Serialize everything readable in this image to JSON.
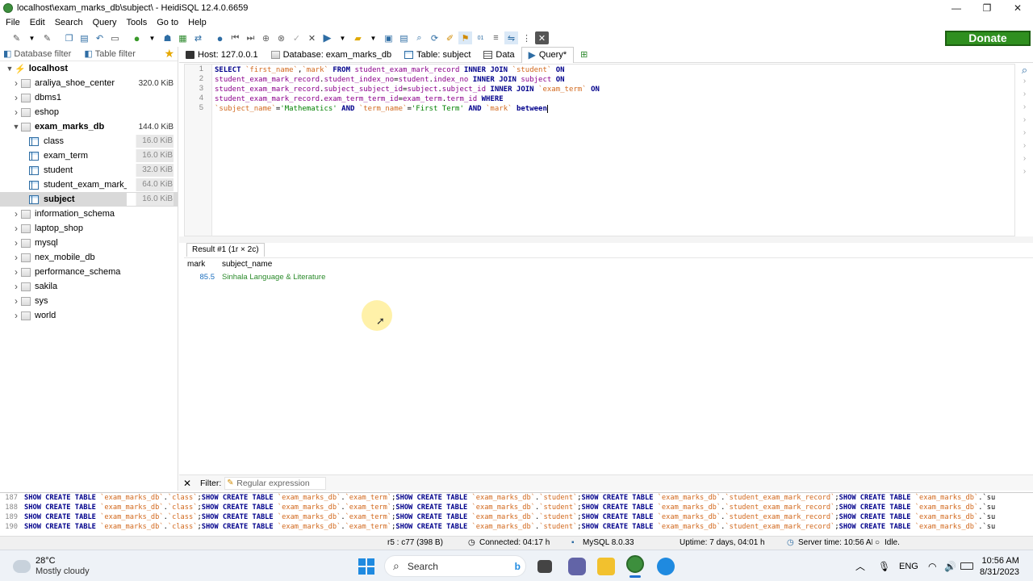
{
  "window": {
    "title": "localhost\\exam_marks_db\\subject\\ - HeidiSQL 12.4.0.6659",
    "buttons": [
      "—",
      "❐",
      "✕"
    ]
  },
  "menu": [
    "File",
    "Edit",
    "Search",
    "Query",
    "Tools",
    "Go to",
    "Help"
  ],
  "donate_label": "Donate",
  "left": {
    "database_filter": "Database filter",
    "table_filter": "Table filter",
    "root": "localhost",
    "items": [
      {
        "name": "araliya_shoe_center",
        "size": "320.0 KiB",
        "type": "db",
        "expanded": false
      },
      {
        "name": "dbms1",
        "size": "",
        "type": "db",
        "expanded": false
      },
      {
        "name": "eshop",
        "size": "",
        "type": "db",
        "expanded": false
      },
      {
        "name": "exam_marks_db",
        "size": "144.0 KiB",
        "type": "db",
        "expanded": true
      },
      {
        "name": "class",
        "size": "16.0 KiB",
        "type": "table"
      },
      {
        "name": "exam_term",
        "size": "16.0 KiB",
        "type": "table"
      },
      {
        "name": "student",
        "size": "32.0 KiB",
        "type": "table"
      },
      {
        "name": "student_exam_mark_r...",
        "size": "64.0 KiB",
        "type": "table"
      },
      {
        "name": "subject",
        "size": "16.0 KiB",
        "type": "table",
        "selected": true
      },
      {
        "name": "information_schema",
        "size": "",
        "type": "db",
        "expanded": false
      },
      {
        "name": "laptop_shop",
        "size": "",
        "type": "db",
        "expanded": false
      },
      {
        "name": "mysql",
        "size": "",
        "type": "db",
        "expanded": false
      },
      {
        "name": "nex_mobile_db",
        "size": "",
        "type": "db",
        "expanded": false
      },
      {
        "name": "performance_schema",
        "size": "",
        "type": "db",
        "expanded": false
      },
      {
        "name": "sakila",
        "size": "",
        "type": "db",
        "expanded": false
      },
      {
        "name": "sys",
        "size": "",
        "type": "db",
        "expanded": false
      },
      {
        "name": "world",
        "size": "",
        "type": "db",
        "expanded": false
      }
    ]
  },
  "tabs": {
    "host": "Host: 127.0.0.1",
    "database": "Database: exam_marks_db",
    "table": "Table: subject",
    "data": "Data",
    "query": "Query*"
  },
  "editor": {
    "line_numbers": [
      "1",
      "2",
      "3",
      "4",
      "5"
    ],
    "lines": [
      "SELECT `first_name`,`mark` FROM student_exam_mark_record INNER JOIN `student` ON",
      "student_exam_mark_record.student_index_no=student.index_no INNER JOIN subject ON",
      "student_exam_mark_record.subject_subject_id=subject.subject_id INNER JOIN `exam_term` ON",
      "student_exam_mark_record.exam_term_term_id=exam_term.term_id WHERE",
      "`subject_name`='Mathematics' AND `term_name`='First Term' AND `mark` between"
    ]
  },
  "results": {
    "tab_label": "Result #1 (1r × 2c)",
    "columns": [
      "mark",
      "subject_name"
    ],
    "rows": [
      [
        "85.5",
        "Sinhala Language & Literature"
      ]
    ]
  },
  "filter": {
    "label": "Filter:",
    "placeholder": "Regular expression"
  },
  "log": [
    {
      "n": "187",
      "text": "SHOW CREATE TABLE `exam_marks_db`.`class`;SHOW CREATE TABLE `exam_marks_db`.`exam_term`;SHOW CREATE TABLE `exam_marks_db`.`student`;SHOW CREATE TABLE `exam_marks_db`.`student_exam_mark_record`;SHOW CREATE TABLE `exam_marks_db`.`su"
    },
    {
      "n": "188",
      "text": "SHOW CREATE TABLE `exam_marks_db`.`class`;SHOW CREATE TABLE `exam_marks_db`.`exam_term`;SHOW CREATE TABLE `exam_marks_db`.`student`;SHOW CREATE TABLE `exam_marks_db`.`student_exam_mark_record`;SHOW CREATE TABLE `exam_marks_db`.`su"
    },
    {
      "n": "189",
      "text": "SHOW CREATE TABLE `exam_marks_db`.`class`;SHOW CREATE TABLE `exam_marks_db`.`exam_term`;SHOW CREATE TABLE `exam_marks_db`.`student`;SHOW CREATE TABLE `exam_marks_db`.`student_exam_mark_record`;SHOW CREATE TABLE `exam_marks_db`.`su"
    },
    {
      "n": "190",
      "text": "SHOW CREATE TABLE `exam_marks_db`.`class`;SHOW CREATE TABLE `exam_marks_db`.`exam_term`;SHOW CREATE TABLE `exam_marks_db`.`student`;SHOW CREATE TABLE `exam_marks_db`.`student_exam_mark_record`;SHOW CREATE TABLE `exam_marks_db`.`su"
    }
  ],
  "status": {
    "cursor": "r5 : c77 (398 B)",
    "connected": "Connected: 04:17 h",
    "server": "MySQL 8.0.33",
    "uptime": "Uptime: 7 days, 04:01 h",
    "server_time": "Server time: 10:56 AM",
    "state": "Idle."
  },
  "taskbar": {
    "temperature": "28°C",
    "weather": "Mostly cloudy",
    "search": "Search",
    "lang": "ENG",
    "time": "10:56 AM",
    "date": "8/31/2023"
  }
}
